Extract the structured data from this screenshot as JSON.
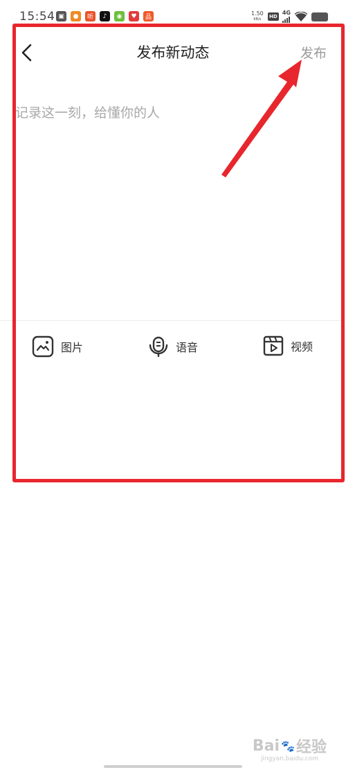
{
  "status_bar": {
    "time": "15:54",
    "notifications": [
      {
        "icon": "gallery-icon",
        "glyph": "▣",
        "color": "#555555"
      },
      {
        "icon": "location-pin-icon",
        "glyph": "●",
        "color": "#f08a24"
      },
      {
        "icon": "listen-app-icon",
        "glyph": "听",
        "color": "#e8542a"
      },
      {
        "icon": "tiktok-icon",
        "glyph": "♪",
        "color": "#111111"
      },
      {
        "icon": "map-app-icon",
        "glyph": "◉",
        "color": "#6cbf3c"
      },
      {
        "icon": "heart-app-icon",
        "glyph": "♥",
        "color": "#e33b3b"
      },
      {
        "icon": "shopping-app-icon",
        "glyph": "品",
        "color": "#f05a28"
      }
    ],
    "net_speed_value": "1.50",
    "net_speed_unit": "KB/s",
    "hd_label": "HD",
    "network_label": "4G"
  },
  "nav": {
    "title": "发布新动态",
    "publish_label": "发布"
  },
  "compose": {
    "placeholder": "记录这一刻，给懂你的人",
    "value": ""
  },
  "media_bar": {
    "items": [
      {
        "label": "图片",
        "icon": "image-icon"
      },
      {
        "label": "语音",
        "icon": "microphone-icon"
      },
      {
        "label": "视频",
        "icon": "video-icon"
      }
    ]
  },
  "watermark": {
    "brand": "Bai",
    "paw": "🐾",
    "suffix": "经验",
    "sub": "jingyan.baidu.com"
  },
  "colors": {
    "annotation": "#e8262d",
    "placeholder": "#a8a8a8",
    "publish_disabled": "#9a9a9a"
  }
}
